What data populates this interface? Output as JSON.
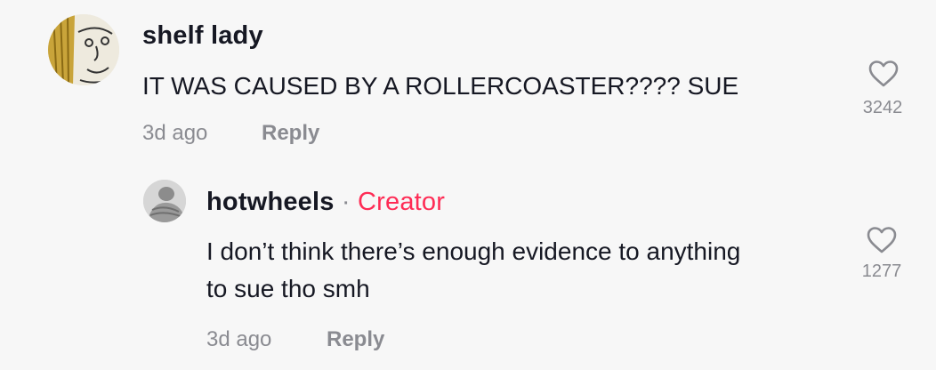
{
  "comment": {
    "username": "shelf lady",
    "text": "IT WAS CAUSED BY A ROLLERCOASTER???? SUE",
    "time": "3d ago",
    "reply_label": "Reply",
    "likes": "3242"
  },
  "reply": {
    "username": "hotwheels",
    "separator": "·",
    "badge": "Creator",
    "text_line1": "I don’t think there’s enough evidence to anything",
    "text_line2": "to sue tho smh",
    "time": "3d ago",
    "reply_label": "Reply",
    "likes": "1277"
  },
  "colors": {
    "background": "#f7f7f7",
    "creator_badge": "#fe2c55",
    "secondary_text": "#8a8b91"
  },
  "icons": {
    "like": "heart-outline-icon"
  }
}
